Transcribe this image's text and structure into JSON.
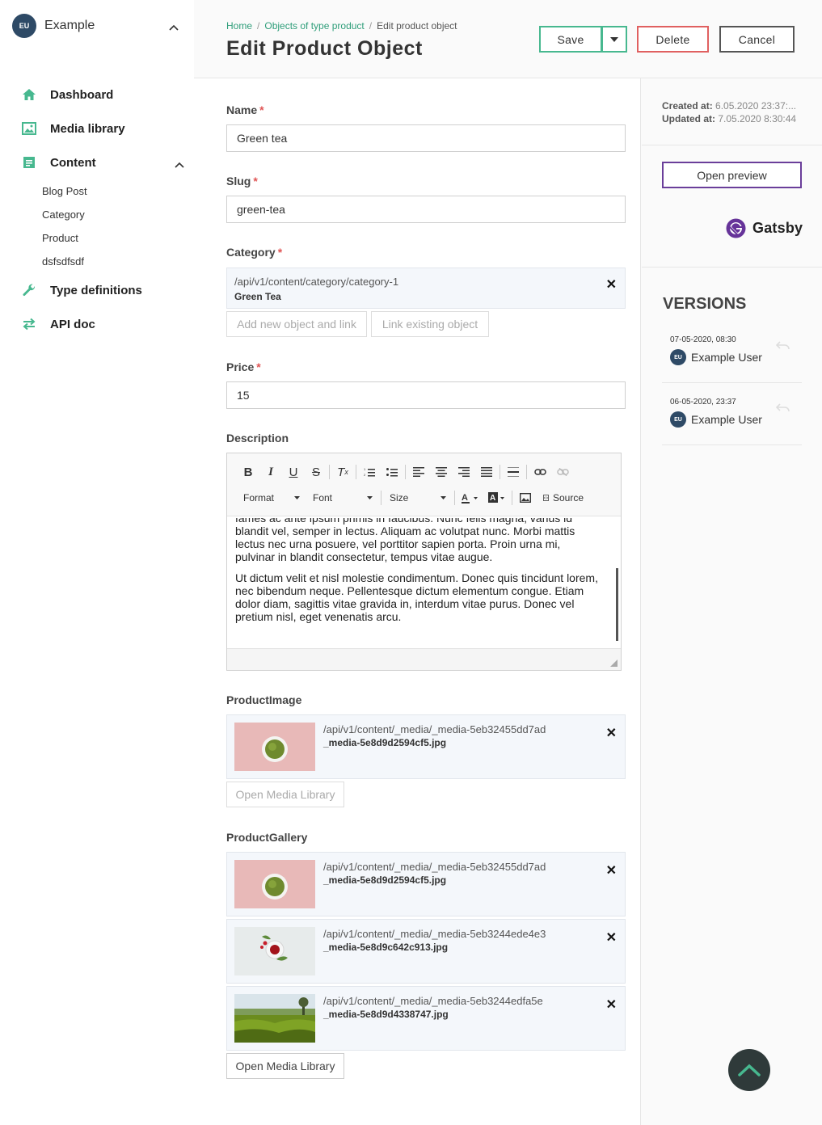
{
  "sidebar": {
    "avatar": "EU",
    "project": "Example",
    "items": [
      {
        "label": "Dashboard"
      },
      {
        "label": "Media library"
      },
      {
        "label": "Content"
      },
      {
        "label": "Type definitions"
      },
      {
        "label": "API doc"
      }
    ],
    "content_sub": [
      "Blog Post",
      "Category",
      "Product",
      "dsfsdfsdf"
    ]
  },
  "header": {
    "breadcrumbs": [
      "Home",
      "Objects of type product",
      "Edit product object"
    ],
    "title": "Edit Product Object",
    "save": "Save",
    "delete": "Delete",
    "cancel": "Cancel"
  },
  "form": {
    "name_label": "Name",
    "name_value": "Green tea",
    "slug_label": "Slug",
    "slug_value": "green-tea",
    "category_label": "Category",
    "category_path": "/api/v1/content/category/category-1",
    "category_name": "Green Tea",
    "add_new": "Add new object and link",
    "link_existing": "Link existing object",
    "price_label": "Price",
    "price_value": "15",
    "description_label": "Description",
    "editor": {
      "format": "Format",
      "font": "Font",
      "size": "Size",
      "source": "Source",
      "p1": "fames ac ante ipsum primis in faucibus. Nunc felis magna, varius id blandit vel, semper in lectus. Aliquam ac volutpat nunc. Morbi mattis lectus nec urna posuere, vel porttitor sapien porta. Proin urna mi, pulvinar in blandit consectetur, tempus vitae augue.",
      "p2": "Ut dictum velit et nisl molestie condimentum. Donec quis tincidunt lorem, nec bibendum neque. Pellentesque dictum elementum congue. Etiam dolor diam, sagittis vitae gravida in, interdum vitae purus. Donec vel pretium nisl, eget venenatis arcu."
    },
    "product_image_label": "ProductImage",
    "product_image": {
      "path": "/api/v1/content/_media/_media-5eb32455dd7ad",
      "name": "_media-5e8d9d2594cf5.jpg"
    },
    "open_media": "Open Media Library",
    "gallery_label": "ProductGallery",
    "gallery": [
      {
        "path": "/api/v1/content/_media/_media-5eb32455dd7ad",
        "name": "_media-5e8d9d2594cf5.jpg"
      },
      {
        "path": "/api/v1/content/_media/_media-5eb3244ede4e3",
        "name": "_media-5e8d9c642c913.jpg"
      },
      {
        "path": "/api/v1/content/_media/_media-5eb3244edfa5e",
        "name": "_media-5e8d9d4338747.jpg"
      }
    ],
    "open_media2": "Open Media Library",
    "required_mark": "*"
  },
  "right": {
    "created_label": "Created at:",
    "created_value": "6.05.2020 23:37:...",
    "updated_label": "Updated at:",
    "updated_value": "7.05.2020 8:30:44",
    "preview": "Open preview",
    "gatsby": "Gatsby",
    "versions_title": "VERSIONS",
    "versions": [
      {
        "date": "07-05-2020, 08:30",
        "avatar": "EU",
        "user": "Example User"
      },
      {
        "date": "06-05-2020, 23:37",
        "avatar": "EU",
        "user": "Example User"
      }
    ]
  },
  "icons": {
    "dashboard": "home-icon",
    "media": "image-icon",
    "content": "document-icon",
    "types": "wrench-icon",
    "api": "arrows-icon",
    "accent": "#47b88f"
  }
}
